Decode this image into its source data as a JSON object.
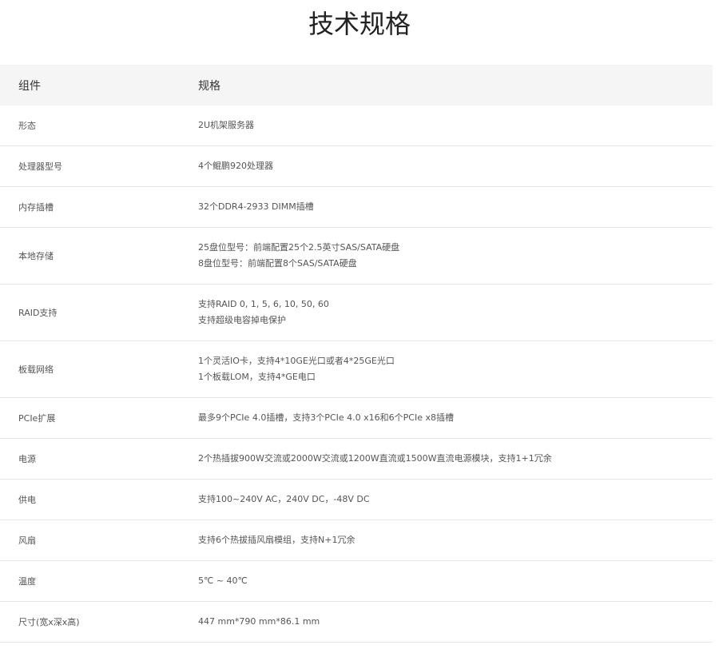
{
  "title": "技术规格",
  "table": {
    "header": {
      "component": "组件",
      "spec": "规格"
    },
    "rows": [
      {
        "component": "形态",
        "spec": [
          "2U机架服务器"
        ]
      },
      {
        "component": "处理器型号",
        "spec": [
          "4个鲲鹏920处理器"
        ]
      },
      {
        "component": "内存插槽",
        "spec": [
          "32个DDR4-2933 DIMM插槽"
        ]
      },
      {
        "component": "本地存储",
        "spec": [
          "25盘位型号：前端配置25个2.5英寸SAS/SATA硬盘",
          "8盘位型号：前端配置8个SAS/SATA硬盘"
        ]
      },
      {
        "component": "RAID支持",
        "spec": [
          "支持RAID 0, 1, 5, 6, 10, 50, 60",
          "支持超级电容掉电保护"
        ]
      },
      {
        "component": "板载网络",
        "spec": [
          "1个灵活IO卡，支持4*10GE光口或者4*25GE光口",
          "1个板载LOM，支持4*GE电口"
        ]
      },
      {
        "component": "PCIe扩展",
        "spec": [
          "最多9个PCIe 4.0插槽，支持3个PCIe 4.0 x16和6个PCIe x8插槽"
        ]
      },
      {
        "component": "电源",
        "spec": [
          "2个热插拔900W交流或2000W交流或1200W直流或1500W直流电源模块，支持1+1冗余"
        ]
      },
      {
        "component": "供电",
        "spec": [
          "支持100~240V AC，240V DC，-48V DC"
        ]
      },
      {
        "component": "风扇",
        "spec": [
          "支持6个热拔插风扇模组，支持N+1冗余"
        ]
      },
      {
        "component": "温度",
        "spec": [
          "5℃ ~ 40℃"
        ]
      },
      {
        "component": "尺寸(宽x深x高)",
        "spec": [
          "447 mm*790 mm*86.1 mm"
        ]
      }
    ]
  }
}
